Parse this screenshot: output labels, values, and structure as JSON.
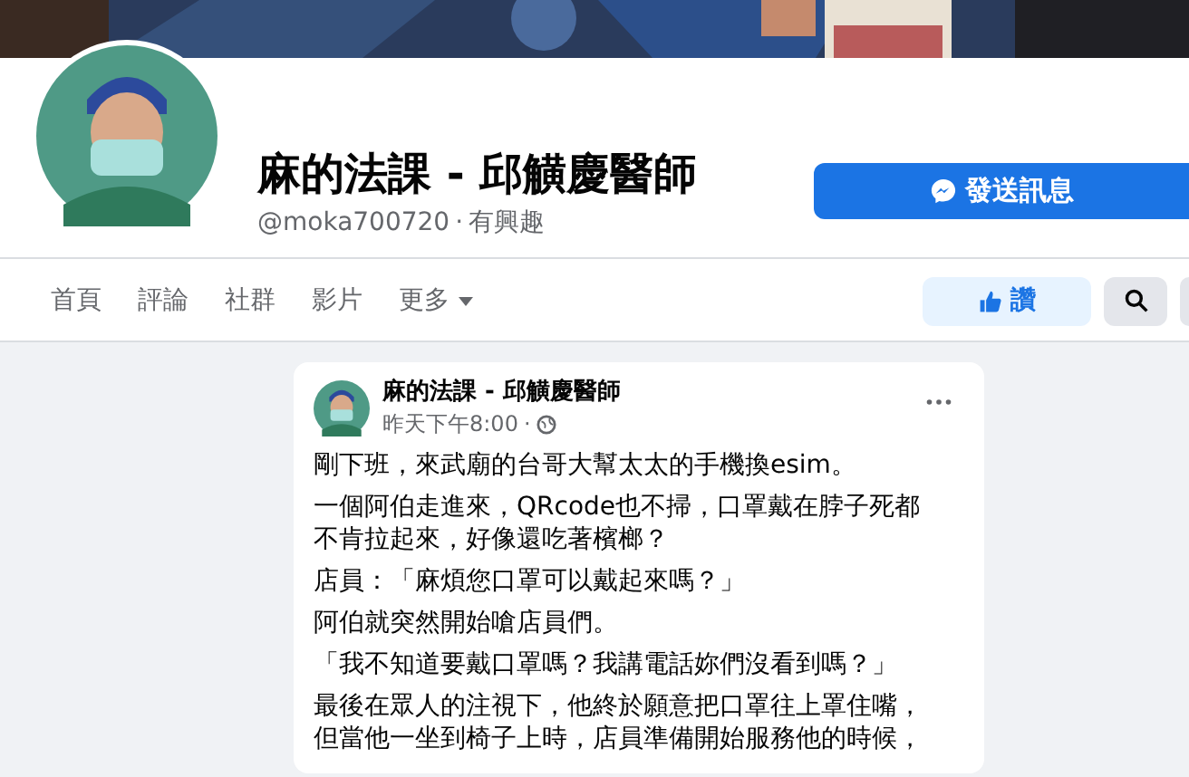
{
  "profile": {
    "name": "麻的法課 - 邱觵慶醫師",
    "handle": "@moka700720",
    "separator": "·",
    "category": "有興趣",
    "message_button": "發送訊息"
  },
  "tabs": [
    {
      "label": "首頁",
      "selected": false
    },
    {
      "label": "評論",
      "selected": false
    },
    {
      "label": "社群",
      "selected": false
    },
    {
      "label": "影片",
      "selected": false
    },
    {
      "label": "更多",
      "selected": false,
      "dropdown": true
    }
  ],
  "like_button": "讚",
  "post": {
    "author": "麻的法課 - 邱觵慶醫師",
    "time": "昨天下午8:00",
    "separator": "·",
    "paragraphs": [
      "剛下班，來武廟的台哥大幫太太的手機換esim。",
      "一個阿伯走進來，QRcode也不掃，口罩戴在脖子死都不肯拉起來，好像還吃著檳榔？",
      "店員：「麻煩您口罩可以戴起來嗎？」",
      "阿伯就突然開始嗆店員們。",
      "「我不知道要戴口罩嗎？我講電話妳們沒看到嗎？」",
      "最後在眾人的注視下，他終於願意把口罩往上罩住嘴，但當他一坐到椅子上時，店員準備開始服務他的時候，"
    ]
  }
}
